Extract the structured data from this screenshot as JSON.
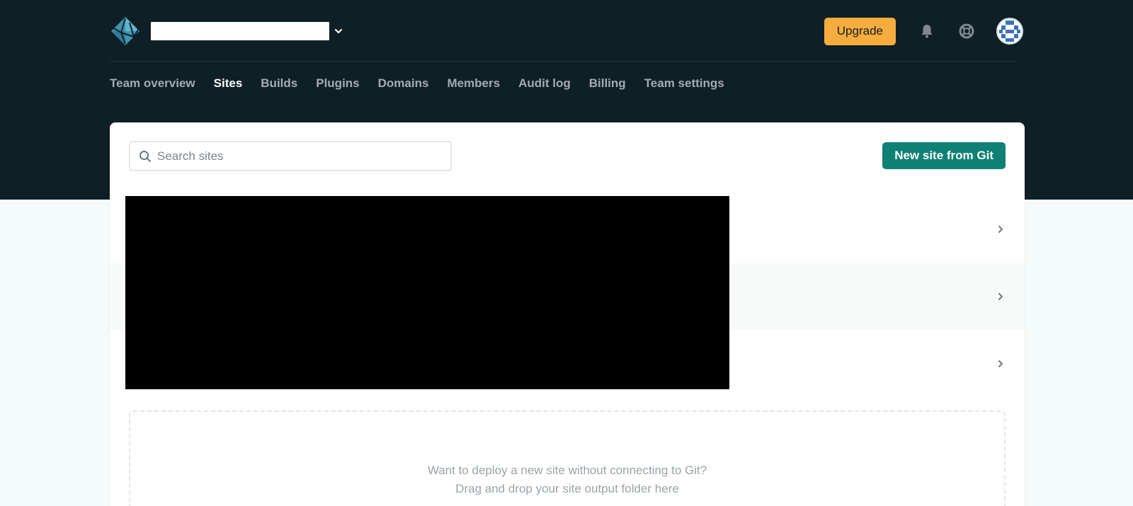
{
  "header": {
    "upgrade_label": "Upgrade",
    "icons": [
      "netlify-logo-icon",
      "chevron-down-icon",
      "bell-icon",
      "lifebuoy-icon",
      "avatar"
    ]
  },
  "nav": {
    "items": [
      {
        "label": "Team overview",
        "active": false
      },
      {
        "label": "Sites",
        "active": true
      },
      {
        "label": "Builds",
        "active": false
      },
      {
        "label": "Plugins",
        "active": false
      },
      {
        "label": "Domains",
        "active": false
      },
      {
        "label": "Members",
        "active": false
      },
      {
        "label": "Audit log",
        "active": false
      },
      {
        "label": "Billing",
        "active": false
      },
      {
        "label": "Team settings",
        "active": false
      }
    ]
  },
  "sites": {
    "search_placeholder": "Search sites",
    "new_site_label": "New site from Git",
    "row_count": 3
  },
  "dropzone": {
    "line1": "Want to deploy a new site without connecting to Git?",
    "line2": "Drag and drop your site output folder here"
  },
  "colors": {
    "header_bg": "#0f1f26",
    "upgrade": "#f6ad3e",
    "primary": "#0e8074",
    "page_bg": "#f5fbfb"
  }
}
